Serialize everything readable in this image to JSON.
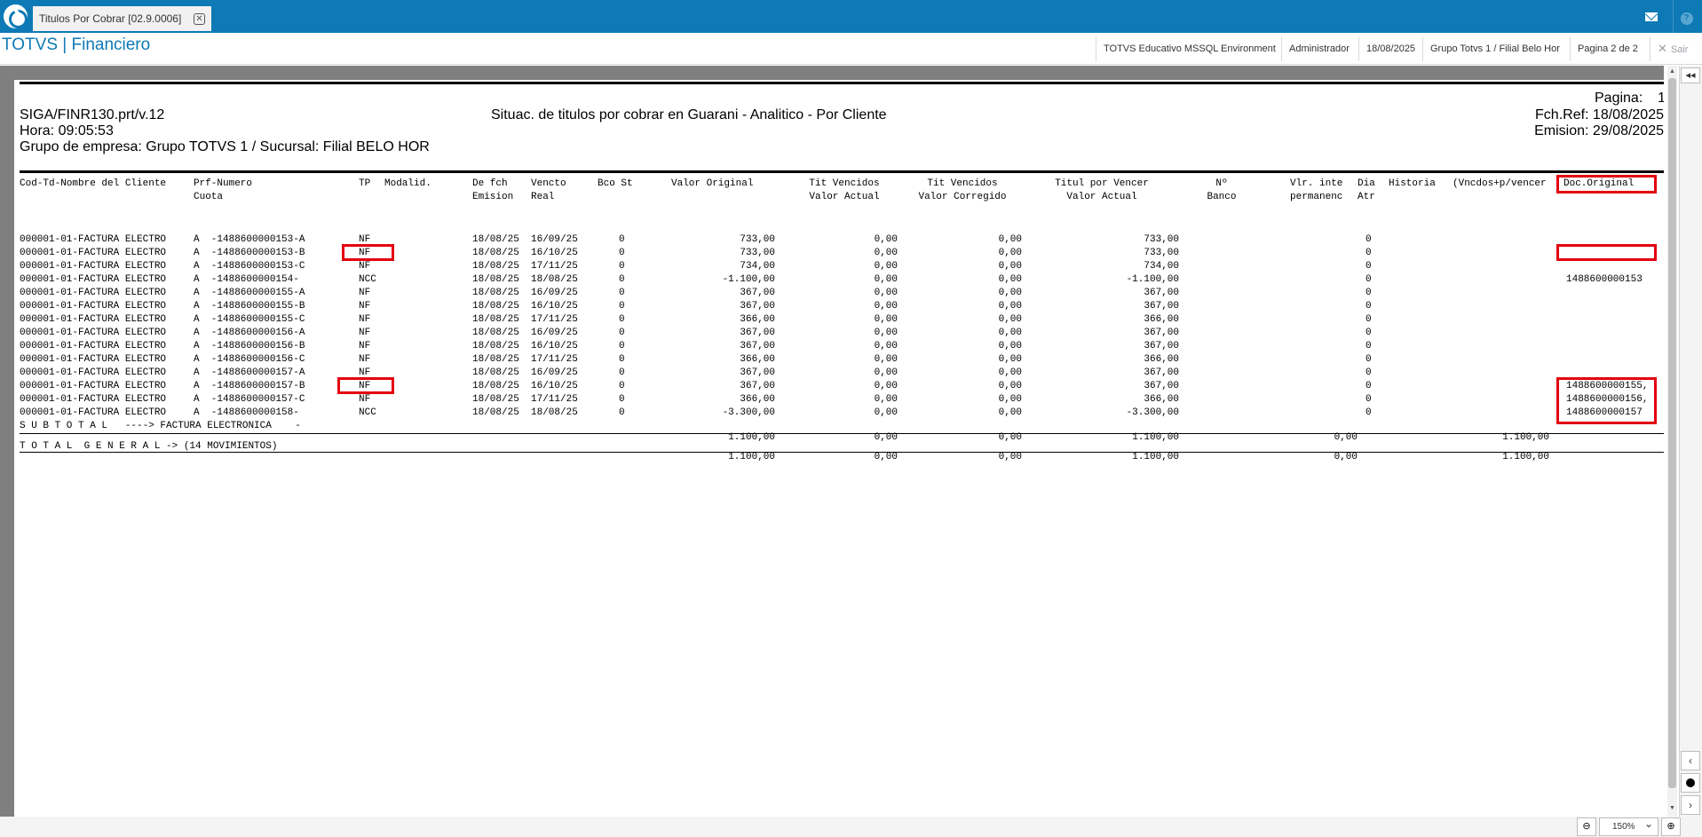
{
  "window": {
    "tab_title": "Titulos Por Cobrar [02.9.0006]"
  },
  "header": {
    "brand": "TOTVS | Financiero",
    "environment": "TOTVS Educativo MSSQL Environment",
    "user": "Administrador",
    "date": "18/08/2025",
    "group": "Grupo Totvs 1 / Filial Belo Hor",
    "page": "Pagina 2 de 2",
    "exit": "Sair"
  },
  "zoom": {
    "level": "150%"
  },
  "report": {
    "program": "SIGA/FINR130.prt/v.12",
    "title": "Situac. de titulos por cobrar en Guarani - Analitico - Por Cliente",
    "hora": "Hora: 09:05:53",
    "grupo": "Grupo de empresa: Grupo TOTVS 1 / Sucursal: Filial BELO HOR",
    "pagina_label": "Pagina:",
    "pagina_num": "1",
    "fch_ref": "Fch.Ref: 18/08/2025",
    "emision": "Emision: 29/08/2025",
    "columns": {
      "cliente": "Cod-Td-Nombre del Cliente",
      "prf1": "Prf-Numero",
      "prf2": "Cuota",
      "tp": "TP",
      "modal": "Modalid.",
      "emis1": "De fch",
      "emis2": "Emision",
      "venc1": "Vencto",
      "venc2": "Real",
      "bco": "Bco St",
      "valor": "Valor Original",
      "titv1": "Tit Vencidos",
      "titv2": "Valor Actual",
      "titc1": "Tit Vencidos",
      "titc2": "Valor Corregido",
      "tpv1": "Titul por Vencer",
      "tpv2": "Valor Actual",
      "nro1": "Nº",
      "nro2": "Banco",
      "vlr1": "Vlr. inte",
      "vlr2": "permanenc",
      "dia1": "Dia",
      "dia2": "Atr",
      "hist": "Historia",
      "vncd": "(Vncdos+p/vencer",
      "doc": "Doc.Original"
    },
    "rows": [
      {
        "cliente": "000001-01-FACTURA ELECTRO",
        "prf": "A  -1488600000153-A",
        "tp": "NF",
        "emis": "18/08/25",
        "venc": "16/09/25",
        "bco": "0",
        "valor": "733,00",
        "titv": "0,00",
        "titc": "0,00",
        "tpv": "733,00",
        "dia": "0",
        "doc": ""
      },
      {
        "cliente": "000001-01-FACTURA ELECTRO",
        "prf": "A  -1488600000153-B",
        "tp": "NF",
        "emis": "18/08/25",
        "venc": "16/10/25",
        "bco": "0",
        "valor": "733,00",
        "titv": "0,00",
        "titc": "0,00",
        "tpv": "733,00",
        "dia": "0",
        "doc": ""
      },
      {
        "cliente": "000001-01-FACTURA ELECTRO",
        "prf": "A  -1488600000153-C",
        "tp": "NF",
        "emis": "18/08/25",
        "venc": "17/11/25",
        "bco": "0",
        "valor": "734,00",
        "titv": "0,00",
        "titc": "0,00",
        "tpv": "734,00",
        "dia": "0",
        "doc": ""
      },
      {
        "cliente": "000001-01-FACTURA ELECTRO",
        "prf": "A  -1488600000154-",
        "tp": "NCC",
        "emis": "18/08/25",
        "venc": "18/08/25",
        "bco": "0",
        "valor": "-1.100,00",
        "titv": "0,00",
        "titc": "0,00",
        "tpv": "-1.100,00",
        "dia": "0",
        "doc": "1488600000153"
      },
      {
        "cliente": "000001-01-FACTURA ELECTRO",
        "prf": "A  -1488600000155-A",
        "tp": "NF",
        "emis": "18/08/25",
        "venc": "16/09/25",
        "bco": "0",
        "valor": "367,00",
        "titv": "0,00",
        "titc": "0,00",
        "tpv": "367,00",
        "dia": "0",
        "doc": ""
      },
      {
        "cliente": "000001-01-FACTURA ELECTRO",
        "prf": "A  -1488600000155-B",
        "tp": "NF",
        "emis": "18/08/25",
        "venc": "16/10/25",
        "bco": "0",
        "valor": "367,00",
        "titv": "0,00",
        "titc": "0,00",
        "tpv": "367,00",
        "dia": "0",
        "doc": ""
      },
      {
        "cliente": "000001-01-FACTURA ELECTRO",
        "prf": "A  -1488600000155-C",
        "tp": "NF",
        "emis": "18/08/25",
        "venc": "17/11/25",
        "bco": "0",
        "valor": "366,00",
        "titv": "0,00",
        "titc": "0,00",
        "tpv": "366,00",
        "dia": "0",
        "doc": ""
      },
      {
        "cliente": "000001-01-FACTURA ELECTRO",
        "prf": "A  -1488600000156-A",
        "tp": "NF",
        "emis": "18/08/25",
        "venc": "16/09/25",
        "bco": "0",
        "valor": "367,00",
        "titv": "0,00",
        "titc": "0,00",
        "tpv": "367,00",
        "dia": "0",
        "doc": ""
      },
      {
        "cliente": "000001-01-FACTURA ELECTRO",
        "prf": "A  -1488600000156-B",
        "tp": "NF",
        "emis": "18/08/25",
        "venc": "16/10/25",
        "bco": "0",
        "valor": "367,00",
        "titv": "0,00",
        "titc": "0,00",
        "tpv": "367,00",
        "dia": "0",
        "doc": ""
      },
      {
        "cliente": "000001-01-FACTURA ELECTRO",
        "prf": "A  -1488600000156-C",
        "tp": "NF",
        "emis": "18/08/25",
        "venc": "17/11/25",
        "bco": "0",
        "valor": "366,00",
        "titv": "0,00",
        "titc": "0,00",
        "tpv": "366,00",
        "dia": "0",
        "doc": ""
      },
      {
        "cliente": "000001-01-FACTURA ELECTRO",
        "prf": "A  -1488600000157-A",
        "tp": "NF",
        "emis": "18/08/25",
        "venc": "16/09/25",
        "bco": "0",
        "valor": "367,00",
        "titv": "0,00",
        "titc": "0,00",
        "tpv": "367,00",
        "dia": "0",
        "doc": ""
      },
      {
        "cliente": "000001-01-FACTURA ELECTRO",
        "prf": "A  -1488600000157-B",
        "tp": "NF",
        "emis": "18/08/25",
        "venc": "16/10/25",
        "bco": "0",
        "valor": "367,00",
        "titv": "0,00",
        "titc": "0,00",
        "tpv": "367,00",
        "dia": "0",
        "doc": ""
      },
      {
        "cliente": "000001-01-FACTURA ELECTRO",
        "prf": "A  -1488600000157-C",
        "tp": "NF",
        "emis": "18/08/25",
        "venc": "17/11/25",
        "bco": "0",
        "valor": "366,00",
        "titv": "0,00",
        "titc": "0,00",
        "tpv": "366,00",
        "dia": "0",
        "doc": ""
      },
      {
        "cliente": "000001-01-FACTURA ELECTRO",
        "prf": "A  -1488600000158-",
        "tp": "NCC",
        "emis": "18/08/25",
        "venc": "18/08/25",
        "bco": "0",
        "valor": "-3.300,00",
        "titv": "0,00",
        "titc": "0,00",
        "tpv": "-3.300,00",
        "dia": "0",
        "doc": ""
      }
    ],
    "doc_multi": [
      "1488600000155,",
      "1488600000156,",
      "1488600000157"
    ],
    "subtotal_label": "S U B T O T A L   ----> FACTURA ELECTRONICA    -",
    "subtotal": {
      "valor": "1.100,00",
      "titv": "0,00",
      "titc": "0,00",
      "tpv": "1.100,00",
      "vlr": "0,00",
      "vncd": "1.100,00"
    },
    "total_label": "T O T A L  G E N E R A L -> (14 MOVIMIENTOS)",
    "total": {
      "valor": "1.100,00",
      "titv": "0,00",
      "titc": "0,00",
      "tpv": "1.100,00",
      "vlr": "0,00",
      "vncd": "1.100,00"
    }
  },
  "colors": {
    "brand_blue": "#0d79b5",
    "highlight_red": "#e3000f"
  }
}
